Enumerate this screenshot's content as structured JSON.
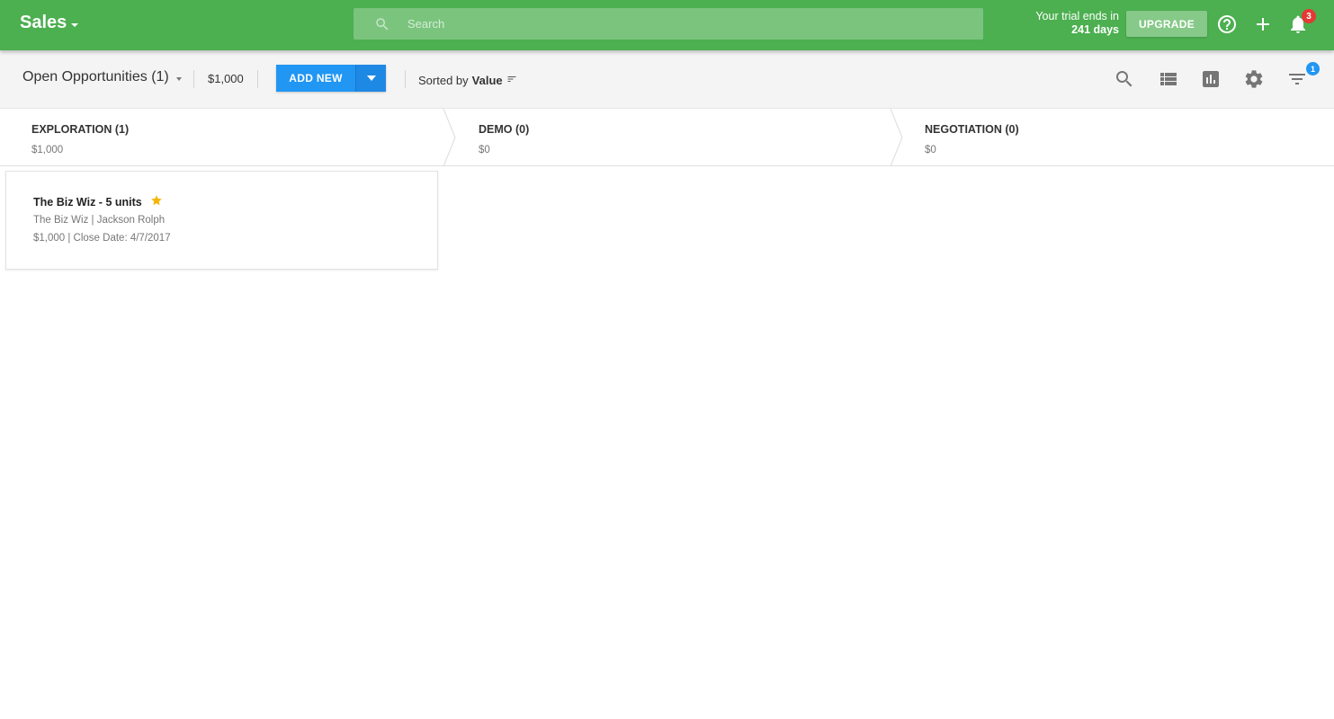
{
  "app": {
    "title": "Sales",
    "search_placeholder": "Search",
    "trial_text": "Your trial ends in",
    "trial_days": "241 days",
    "upgrade_label": "UPGRADE",
    "notifications_count": "3",
    "colors": {
      "appbar": "#4caf50",
      "primary_button": "#2196f3",
      "star": "#f5b400",
      "badge_red": "#e53935"
    }
  },
  "toolbar": {
    "view_label": "Open Opportunities (1)",
    "total_value": "$1,000",
    "add_new_label": "ADD NEW",
    "sorted_prefix": "Sorted by",
    "sorted_value": "Value",
    "filter_count": "1",
    "icons": [
      "search-icon",
      "list-view-icon",
      "chart-icon",
      "settings-icon",
      "filter-icon"
    ]
  },
  "stages": [
    {
      "name": "EXPLORATION (1)",
      "amount": "$1,000"
    },
    {
      "name": "DEMO (0)",
      "amount": "$0"
    },
    {
      "name": "NEGOTIATION (0)",
      "amount": "$0"
    }
  ],
  "cards": [
    {
      "title": "The Biz Wiz - 5 units",
      "starred": true,
      "company_contact": "The Biz Wiz | Jackson Rolph",
      "value_close": "$1,000 | Close Date: 4/7/2017"
    }
  ]
}
